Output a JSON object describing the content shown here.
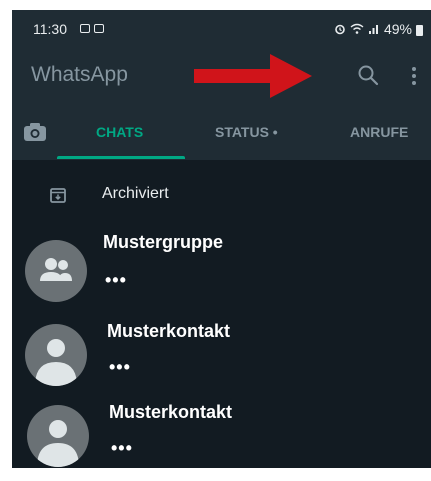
{
  "status_bar": {
    "time": "11:30",
    "battery": "49%"
  },
  "app": {
    "title": "WhatsApp"
  },
  "tabs": [
    {
      "label": "CHATS",
      "active": true
    },
    {
      "label": "STATUS •",
      "active": false
    },
    {
      "label": "ANRUFE",
      "active": false
    }
  ],
  "archived": {
    "label": "Archiviert"
  },
  "chats": [
    {
      "name": "Mustergruppe",
      "preview": "•••",
      "avatar": "group-avatar-icon"
    },
    {
      "name": "Musterkontakt",
      "preview": "•••",
      "avatar": "contact-avatar-icon"
    },
    {
      "name": "Musterkontakt",
      "preview": "•••",
      "avatar": "contact-avatar-icon"
    }
  ],
  "colors": {
    "background": "#121b22",
    "header": "#1f2c34",
    "accent": "#00a884",
    "muted": "#8696a0",
    "arrow": "#d0141a"
  }
}
